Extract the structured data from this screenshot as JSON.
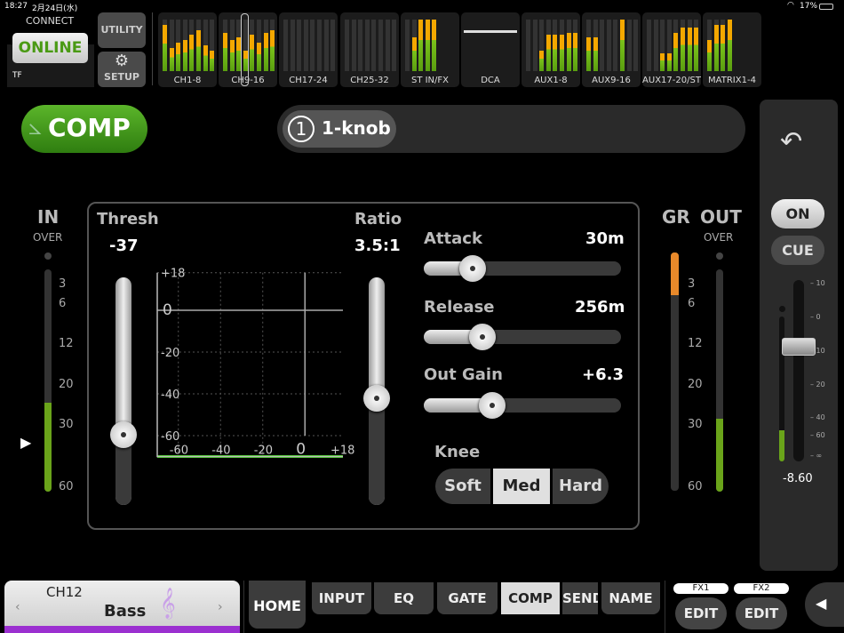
{
  "status": {
    "time": "18:27",
    "date": "2月24日(水)",
    "battery": "17%"
  },
  "connect": {
    "label": "CONNECT",
    "state": "ONLINE",
    "device": "TF"
  },
  "utility_label": "UTILITY",
  "setup_label": "SETUP",
  "banks": [
    {
      "label": "CH1-8",
      "levels": [
        0.9,
        0.45,
        0.55,
        0.6,
        0.7,
        0.8,
        0.5,
        0.4
      ]
    },
    {
      "label": "CH9-16",
      "levels": [
        0.75,
        0.6,
        0.65,
        0.4,
        0.7,
        0.55,
        0.75,
        0.8
      ]
    },
    {
      "label": "CH17-24",
      "levels": [
        0,
        0,
        0,
        0,
        0,
        0,
        0,
        0
      ]
    },
    {
      "label": "CH25-32",
      "levels": [
        0,
        0,
        0,
        0,
        0,
        0,
        0,
        0
      ]
    },
    {
      "label": "ST IN/FX",
      "levels": [
        0,
        0.65,
        1,
        1,
        1
      ]
    },
    {
      "label": "DCA",
      "levels": []
    },
    {
      "label": "AUX1-8",
      "levels": [
        0,
        0,
        0.4,
        0.7,
        0.7,
        0.7,
        0.75,
        0.75
      ]
    },
    {
      "label": "AUX9-16",
      "levels": [
        0.65,
        0.65,
        0,
        0,
        0,
        1,
        0,
        0
      ]
    },
    {
      "label": "AUX17-20/ST",
      "levels": [
        0,
        0,
        0.35,
        0.35,
        0.75,
        0.85,
        0.85,
        0.85
      ]
    },
    {
      "label": "MATRIX1-4",
      "levels": [
        0.6,
        0.9,
        0.9,
        1
      ]
    }
  ],
  "module": {
    "title": "COMP",
    "mode_number": "1",
    "mode_label": "1-knob"
  },
  "in_meter": {
    "label": "IN",
    "over": "OVER",
    "scale": [
      "3",
      "6",
      "12",
      "20",
      "30",
      "60"
    ],
    "level": 0.4
  },
  "thresh": {
    "label": "Thresh",
    "value": "-37",
    "position": 0.34
  },
  "ratio": {
    "label": "Ratio",
    "value": "3.5:1",
    "position": 0.53
  },
  "graph": {
    "y_ticks": [
      "+18",
      "0",
      "-20",
      "-40",
      "-60"
    ],
    "x_ticks": [
      "-60",
      "-40",
      "-20",
      "0",
      "+18"
    ],
    "threshold_db": -37,
    "ratio": 3.5,
    "gain_db": 6.3,
    "color": "#3ccf1a"
  },
  "attack": {
    "label": "Attack",
    "value": "30m",
    "position": 0.25
  },
  "release": {
    "label": "Release",
    "value": "256m",
    "position": 0.3
  },
  "out_gain": {
    "label": "Out Gain",
    "value": "+6.3",
    "position": 0.35
  },
  "knee": {
    "label": "Knee",
    "options": [
      "Soft",
      "Med",
      "Hard"
    ],
    "selected": "Med"
  },
  "gr_meter": {
    "label": "GR",
    "level": 0.18,
    "color": "#e8892a"
  },
  "out_meter": {
    "label": "OUT",
    "over": "OVER",
    "scale": [
      "3",
      "6",
      "12",
      "20",
      "30",
      "60"
    ],
    "level": 0.33
  },
  "fader": {
    "on": "ON",
    "cue": "CUE",
    "scale": [
      "10",
      "0",
      "10",
      "20",
      "40",
      "60",
      "∞"
    ],
    "value": "-8.60"
  },
  "channel": {
    "id": "CH12",
    "name": "Bass",
    "color": "#9b30d0"
  },
  "tabs": [
    "HOME",
    "INPUT",
    "EQ",
    "GATE",
    "COMP",
    "SEND",
    "NAME"
  ],
  "active_tab": "COMP",
  "fx": [
    {
      "label": "FX1",
      "edit": "EDIT"
    },
    {
      "label": "FX2",
      "edit": "EDIT"
    }
  ]
}
